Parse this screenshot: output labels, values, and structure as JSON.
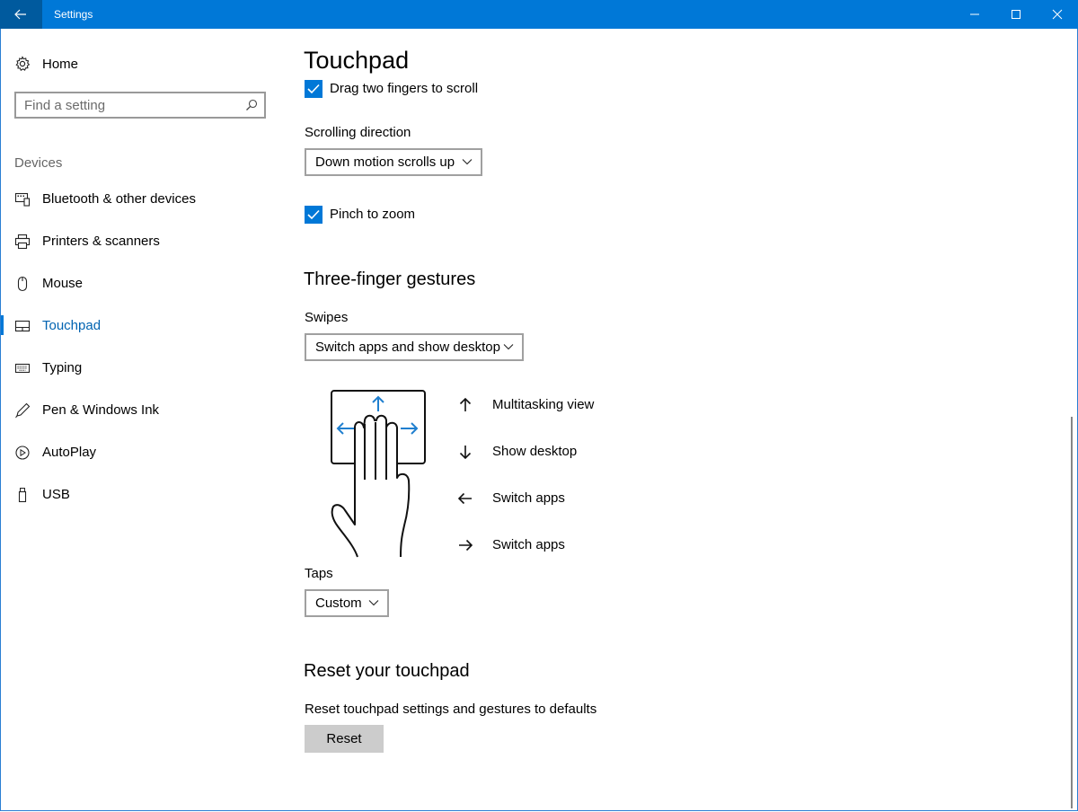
{
  "window": {
    "title": "Settings"
  },
  "sidebar": {
    "home_label": "Home",
    "search": {
      "placeholder": "Find a setting"
    },
    "group_label": "Devices",
    "items": [
      {
        "label": "Bluetooth & other devices",
        "icon": "bluetooth-devices-icon"
      },
      {
        "label": "Printers & scanners",
        "icon": "printer-icon"
      },
      {
        "label": "Mouse",
        "icon": "mouse-icon"
      },
      {
        "label": "Touchpad",
        "icon": "touchpad-icon",
        "active": true
      },
      {
        "label": "Typing",
        "icon": "keyboard-icon"
      },
      {
        "label": "Pen & Windows Ink",
        "icon": "pen-icon"
      },
      {
        "label": "AutoPlay",
        "icon": "autoplay-icon"
      },
      {
        "label": "USB",
        "icon": "usb-icon"
      }
    ]
  },
  "main": {
    "title": "Touchpad",
    "drag_scroll": {
      "label": "Drag two fingers to scroll",
      "checked": true
    },
    "scrolling_direction": {
      "label": "Scrolling direction",
      "value": "Down motion scrolls up"
    },
    "pinch_zoom": {
      "label": "Pinch to zoom",
      "checked": true
    },
    "three_finger": {
      "heading": "Three-finger gestures",
      "swipes_label": "Swipes",
      "swipes_value": "Switch apps and show desktop",
      "gestures": [
        {
          "icon": "arrow-up-icon",
          "label": "Multitasking view"
        },
        {
          "icon": "arrow-down-icon",
          "label": "Show desktop"
        },
        {
          "icon": "arrow-left-icon",
          "label": "Switch apps"
        },
        {
          "icon": "arrow-right-icon",
          "label": "Switch apps"
        }
      ],
      "taps_label": "Taps",
      "taps_value": "Custom"
    },
    "reset": {
      "heading": "Reset your touchpad",
      "description": "Reset touchpad settings and gestures to defaults",
      "button_label": "Reset"
    }
  },
  "colors": {
    "accent": "#0078d7",
    "titlebar": "#0078d7",
    "back_button": "#005a9e",
    "button_gray": "#cccccc"
  }
}
